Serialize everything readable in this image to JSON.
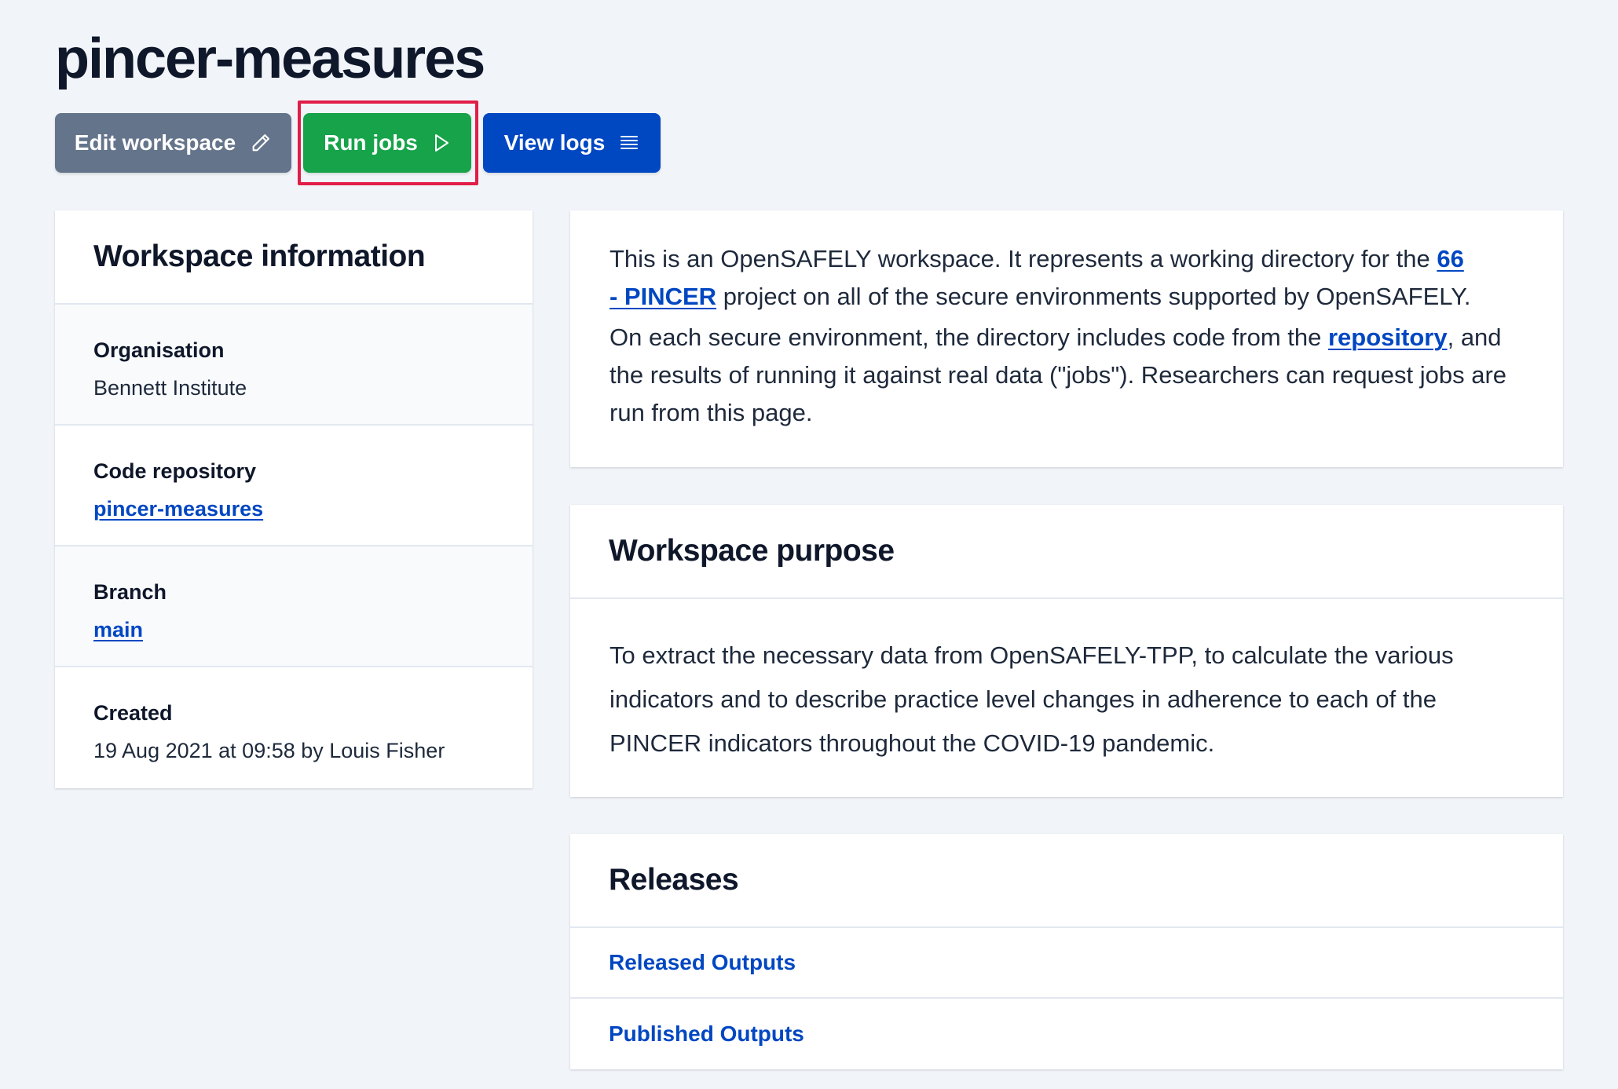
{
  "page": {
    "title": "pincer-measures"
  },
  "toolbar": {
    "edit_label": "Edit workspace",
    "edit_icon": "pencil-icon",
    "run_label": "Run jobs",
    "run_icon": "play-icon",
    "logs_label": "View logs",
    "logs_icon": "list-icon"
  },
  "info": {
    "heading": "Workspace information",
    "organisation_label": "Organisation",
    "organisation_value": "Bennett Institute",
    "repo_label": "Code repository",
    "repo_value": "pincer-measures",
    "branch_label": "Branch",
    "branch_value": "main",
    "created_label": "Created",
    "created_value": "19 Aug 2021 at 09:58 by Louis Fisher"
  },
  "description": {
    "p1_pre": "This is an OpenSAFELY workspace. It represents a working directory for the ",
    "project_link_1": "66",
    "project_link_2": "- PINCER",
    "p1_post": " project on all of the secure environments supported by OpenSAFELY.",
    "p2_pre": "On each secure environment, the directory includes code from the ",
    "repo_link": "repository",
    "p2_post": ", and the results of running it against real data (\"jobs\"). Researchers can request jobs are run from this page."
  },
  "purpose": {
    "heading": "Workspace purpose",
    "line1": "To extract the necessary data from OpenSAFELY-TPP, to calculate the various",
    "line2": "indicators and to describe practice level changes in adherence to each of the",
    "line3": "PINCER indicators throughout the COVID-19 pandemic."
  },
  "releases": {
    "heading": "Releases",
    "released_outputs": "Released Outputs",
    "published_outputs": "Published Outputs"
  },
  "colors": {
    "background": "#f1f5f9",
    "edit_button": "#64748b",
    "run_button": "#16a34a",
    "logs_button": "#0047c2",
    "link": "#0047c2",
    "highlight": "#e11d48"
  }
}
